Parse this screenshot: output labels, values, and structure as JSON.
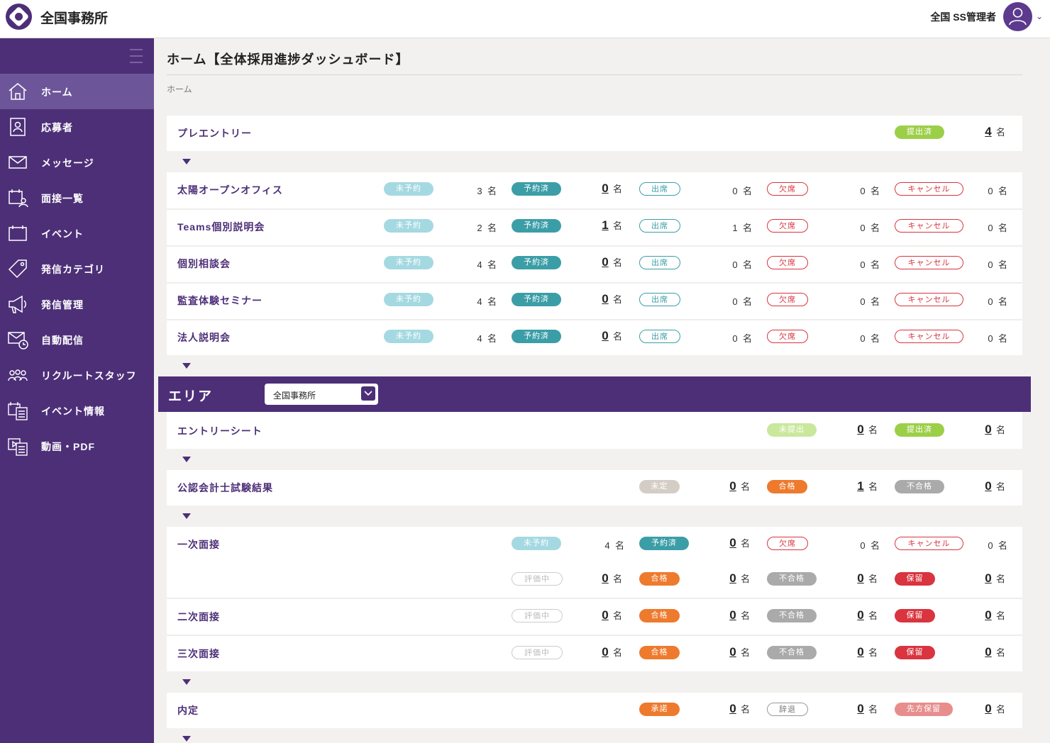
{
  "app": {
    "title": "全国事務所",
    "user_name": "全国 SS管理者"
  },
  "sidebar": {
    "items": [
      {
        "label": "ホーム",
        "icon": "home-icon"
      },
      {
        "label": "応募者",
        "icon": "applicant-icon"
      },
      {
        "label": "メッセージ",
        "icon": "mail-icon"
      },
      {
        "label": "面接一覧",
        "icon": "interview-calendar-icon"
      },
      {
        "label": "イベント",
        "icon": "calendar-icon"
      },
      {
        "label": "発信カテゴリ",
        "icon": "tag-icon"
      },
      {
        "label": "発信管理",
        "icon": "megaphone-icon"
      },
      {
        "label": "自動配信",
        "icon": "auto-mail-icon"
      },
      {
        "label": "リクルートスタッフ",
        "icon": "staff-icon"
      },
      {
        "label": "イベント情報",
        "icon": "event-info-icon"
      },
      {
        "label": "動画・PDF",
        "icon": "video-pdf-icon"
      }
    ]
  },
  "page": {
    "title": "ホーム【全体採用進捗ダッシュボード】",
    "breadcrumb": "ホーム"
  },
  "unit": "名",
  "pre_entry": {
    "label": "プレエントリー",
    "status": "提出済",
    "count": "4"
  },
  "labels": {
    "unreserved": "未予約",
    "reserved": "予約済",
    "attended": "出席",
    "absent": "欠席",
    "cancel": "キャンセル"
  },
  "events": [
    {
      "name": "太陽オープンオフィス",
      "unreserved": "3",
      "reserved": "0",
      "attended": "0",
      "absent": "0",
      "cancel": "0"
    },
    {
      "name": "Teams個別説明会",
      "unreserved": "2",
      "reserved": "1",
      "attended": "1",
      "absent": "0",
      "cancel": "0"
    },
    {
      "name": "個別相談会",
      "unreserved": "4",
      "reserved": "0",
      "attended": "0",
      "absent": "0",
      "cancel": "0"
    },
    {
      "name": "監査体験セミナー",
      "unreserved": "4",
      "reserved": "0",
      "attended": "0",
      "absent": "0",
      "cancel": "0"
    },
    {
      "name": "法人説明会",
      "unreserved": "4",
      "reserved": "0",
      "attended": "0",
      "absent": "0",
      "cancel": "0"
    }
  ],
  "area": {
    "title": "エリア",
    "selected": "全国事務所"
  },
  "entry_sheet": {
    "label": "エントリーシート",
    "not_submitted": "未提出",
    "not_submitted_count": "0",
    "submitted": "提出済",
    "submitted_count": "0"
  },
  "cpa_result": {
    "label": "公認会計士試験結果",
    "undecided": "未定",
    "undecided_count": "0",
    "pass": "合格",
    "pass_count": "1",
    "fail": "不合格",
    "fail_count": "0"
  },
  "interview_labels": {
    "evaluating": "評価中",
    "pass": "合格",
    "fail": "不合格",
    "hold": "保留"
  },
  "first_interview": {
    "label": "一次面接",
    "unreserved_count": "4",
    "reserved_count": "0",
    "absent_count": "0",
    "cancel_count": "0",
    "evaluating_count": "0",
    "pass_count": "0",
    "fail_count": "0",
    "hold_count": "0"
  },
  "second_interview": {
    "label": "二次面接",
    "evaluating_count": "0",
    "pass_count": "0",
    "fail_count": "0",
    "hold_count": "0"
  },
  "third_interview": {
    "label": "三次面接",
    "evaluating_count": "0",
    "pass_count": "0",
    "fail_count": "0",
    "hold_count": "0"
  },
  "offer": {
    "label": "内定",
    "accepted": "承諾",
    "accepted_count": "0",
    "declined": "辞退",
    "declined_count": "0",
    "other_hold": "先方保留",
    "other_hold_count": "0"
  },
  "colors": {
    "brand": "#4d2f78",
    "submitted": "#9ccf48",
    "unreserved": "#a5d9e1",
    "reserved": "#3b9ea7",
    "attended": "#3b9ea7",
    "absent": "#d9343f",
    "pass": "#ee7a2d",
    "fail": "#aaaaaa",
    "hold": "#d9343f",
    "undecided": "#d4cdc5",
    "other_hold": "#e88d8d"
  }
}
